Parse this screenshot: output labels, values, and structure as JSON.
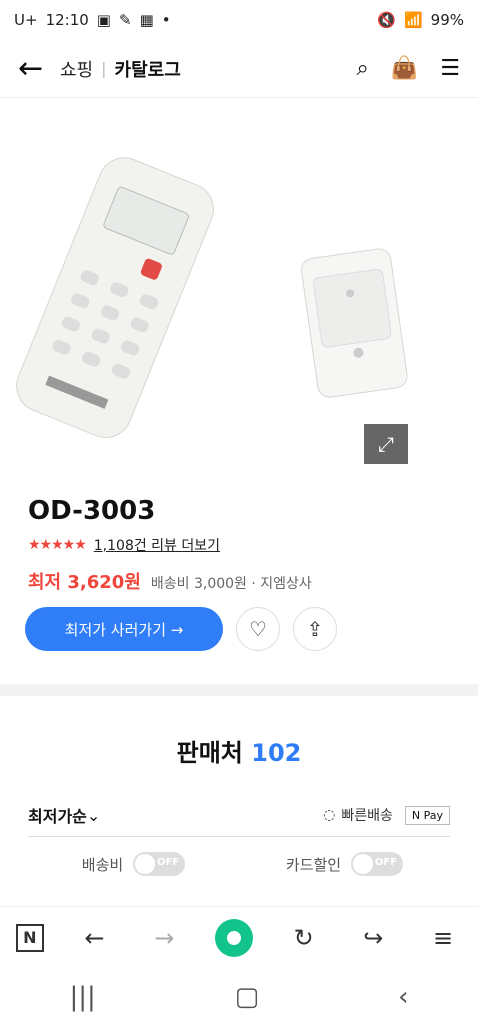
{
  "status": {
    "carrier": "U+",
    "time": "12:10",
    "battery": "99%"
  },
  "header": {
    "brand": "쇼핑",
    "section": "카탈로그"
  },
  "product": {
    "title": "OD-3003",
    "rating_text": "1,108건 리뷰 더보기",
    "price": "최저 3,620원",
    "price_meta": "배송비 3,000원 · 지엠상사",
    "buy_label": "최저가 사러가기 →"
  },
  "sellers": {
    "label": "판매처",
    "count": "102"
  },
  "sort": {
    "label": "최저가순",
    "fast_shipping": "빠른배송",
    "npay": "N Pay"
  },
  "filters": {
    "shipping": "배송비",
    "card": "카드할인",
    "off": "OFF"
  }
}
